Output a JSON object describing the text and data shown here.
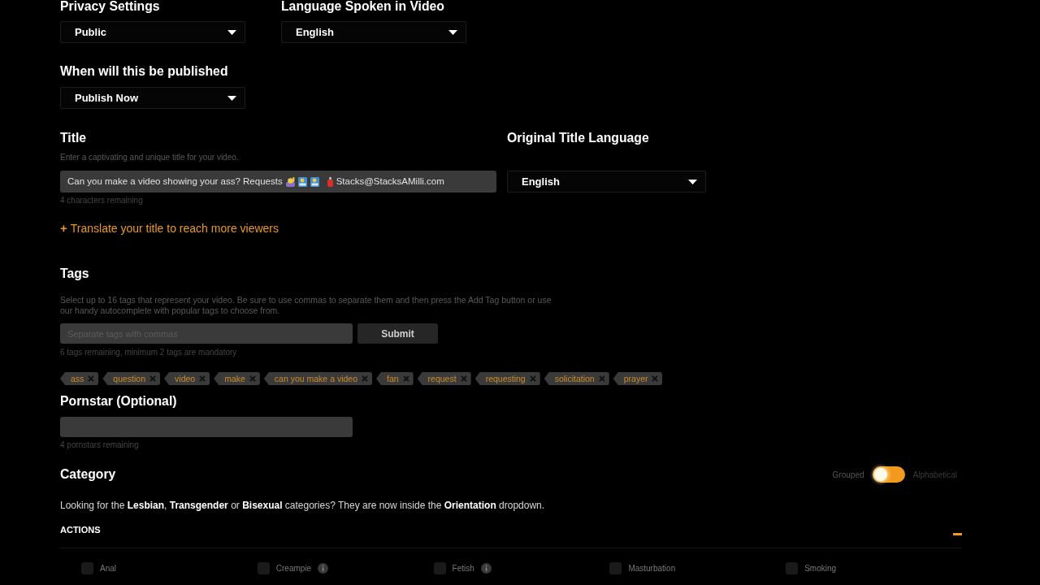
{
  "privacy": {
    "label": "Privacy Settings",
    "value": "Public"
  },
  "language": {
    "label": "Language Spoken in Video",
    "value": "English"
  },
  "publish": {
    "label": "When will this be published",
    "value": "Publish Now"
  },
  "title": {
    "label": "Title",
    "hint": "Enter a captivating and unique title for your video.",
    "value_start": "Can you make a video showing your ass? Requests",
    "value_end": "Stacks@StacksAMilli.com",
    "counter": "4 characters remaining"
  },
  "original_title_language": {
    "label": "Original Title Language",
    "value": "English"
  },
  "translate_link": {
    "icon": "+",
    "text": "Translate your title to reach more viewers"
  },
  "tags": {
    "label": "Tags",
    "description": "Select up to 16 tags that represent your video. Be sure to use commas to separate them and then press the Add Tag button or use our handy autocomplete with popular tags to choose from.",
    "placeholder": "Separate tags with commas",
    "submit": "Submit",
    "counter": "6 tags remaining, minimum 2 tags are mandatory",
    "items": [
      "ass",
      "question",
      "video",
      "make",
      "can you make a video",
      "fan",
      "request",
      "requesting",
      "solicitation",
      "prayer"
    ]
  },
  "pornstar": {
    "label": "Pornstar (Optional)",
    "counter": "4 pornstars remaining"
  },
  "category": {
    "label": "Category",
    "toggle": {
      "left_label": "Grouped",
      "right_label": "Alphabetical",
      "on": false
    },
    "notice": "Looking for the **Lesbian**, **Transgender** or **Bisexual** categories? They are now inside the **Orientation** dropdown.",
    "section": {
      "title": "ACTIONS",
      "expanded": true,
      "items": [
        {
          "label": "Anal",
          "checked": false,
          "info": false
        },
        {
          "label": "Creampie",
          "checked": false,
          "info": true
        },
        {
          "label": "Fetish",
          "checked": false,
          "info": true
        },
        {
          "label": "Masturbation",
          "checked": false,
          "info": false
        },
        {
          "label": "Smoking",
          "checked": false,
          "info": false
        }
      ]
    }
  }
}
